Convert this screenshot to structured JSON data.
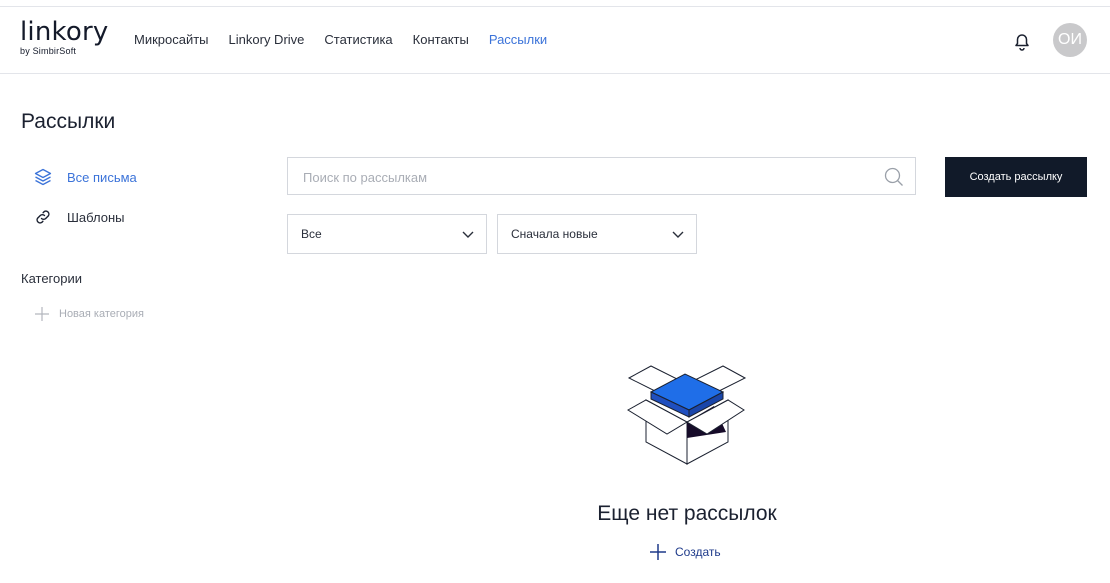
{
  "brand": {
    "logo": "linkory",
    "sub": "by SimbirSoft"
  },
  "nav": [
    {
      "label": "Микросайты"
    },
    {
      "label": "Linkory Drive"
    },
    {
      "label": "Статистика"
    },
    {
      "label": "Контакты"
    },
    {
      "label": "Рассылки",
      "active": true
    }
  ],
  "header": {
    "avatar_initials": "ОИ",
    "bell_icon": "bell-icon"
  },
  "page": {
    "title": "Рассылки"
  },
  "sidebar": {
    "items": [
      {
        "label": "Все письма",
        "icon": "layers-icon",
        "active": true
      },
      {
        "label": "Шаблоны",
        "icon": "link-icon"
      }
    ],
    "categories_title": "Категории",
    "new_category": "Новая категория"
  },
  "toolbar": {
    "search_placeholder": "Поиск по рассылкам",
    "create_label": "Создать рассылку",
    "filter_value": "Все",
    "sort_value": "Сначала новые"
  },
  "empty": {
    "title": "Еще нет рассылок",
    "create_label": "Создать"
  },
  "colors": {
    "accent": "#3b73d9",
    "button_dark": "#111a29",
    "box_blue": "#1f6ee8"
  }
}
